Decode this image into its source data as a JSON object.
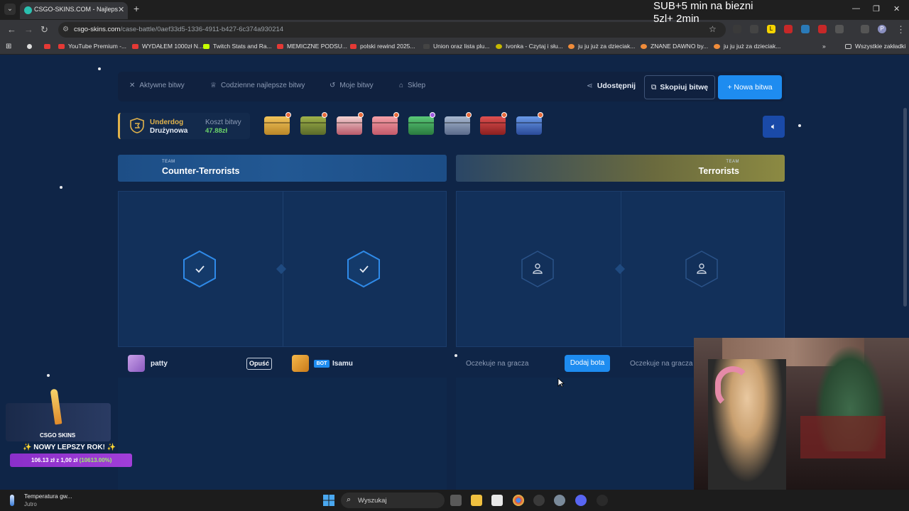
{
  "browser": {
    "tab_title": "CSGO-SKINS.COM - Najlepsze",
    "url_domain": "csgo-skins.com",
    "url_path": "/case-battle/0aef33d5-1336-4911-b427-6c374a930214",
    "bookmarks": [
      {
        "label": "YouTube Premium -...",
        "color": "#e53935"
      },
      {
        "label": "WYDAŁEM 1000zł N...",
        "color": "#e53935"
      },
      {
        "label": "Twitch Stats and Ra...",
        "color": "#c6ff00"
      },
      {
        "label": "MEMICZNE PODSU...",
        "color": "#e53935"
      },
      {
        "label": "polski rewind 2025...",
        "color": "#e53935"
      },
      {
        "label": "Union oraz lista plu...",
        "color": "#444444"
      },
      {
        "label": "Ivonka - Czytaj i słu...",
        "color": "#c6b800"
      },
      {
        "label": "ju ju już za dzieciak...",
        "color": "#f08c3a"
      },
      {
        "label": "ZNANE DAWNO by...",
        "color": "#f08c3a"
      },
      {
        "label": "ju ju już za dzieciak...",
        "color": "#f08c3a"
      }
    ],
    "all_bookmarks": "Wszystkie zakładki"
  },
  "stream_overlay": {
    "line1": "SUB+5 min na biezni",
    "line2": "5zl+ 2min"
  },
  "nav": {
    "active_battles": "Aktywne bitwy",
    "daily_best": "Codzienne najlepsze bitwy",
    "my_battles": "Moje bitwy",
    "shop": "Sklep",
    "share": "Udostępnij",
    "copy_battle": "Skopiuj bitwę",
    "new_battle": "+ Nowa bitwa"
  },
  "battle": {
    "mode_line1": "Underdog",
    "mode_line2": "Drużynowa",
    "cost_label": "Koszt bitwy",
    "cost_value": "47.88zł",
    "case_colors": [
      "#d9a53a",
      "#7a8c3a",
      "#c86b6b",
      "#d97a8a",
      "#3fa85a",
      "#7a8aa8",
      "#c43a3a",
      "#4a7ac8"
    ]
  },
  "teams": {
    "team_label": "TEAM",
    "ct_name": "Counter-Terrorists",
    "t_name": "Terrorists"
  },
  "players": {
    "p1_name": "patty",
    "leave_label": "Opuść",
    "bot_badge": "BOT",
    "p2_name": "Isamu",
    "waiting_label": "Oczekuje na gracza",
    "add_bot_label": "Dodaj bota"
  },
  "promo": {
    "logo": "CSGO SKINS",
    "title": "✨ NOWY LEPSZY ROK! ✨",
    "stats_prefix": "106.13 zł z 1,00 zł",
    "stats_percent": "(10613.00%)"
  },
  "taskbar": {
    "weather_title": "Temperatura gw...",
    "weather_sub": "Jutro",
    "search_label": "Wyszukaj"
  },
  "colors": {
    "accent_blue": "#1e8cf0",
    "background": "#0f2547",
    "gold": "#e0b24b",
    "cost_green": "#6cd46a"
  }
}
